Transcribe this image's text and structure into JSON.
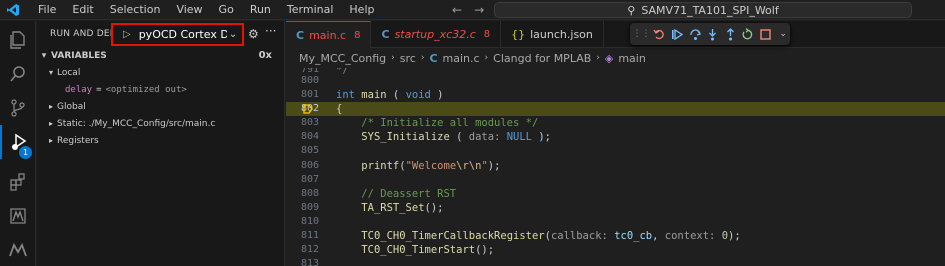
{
  "titlebar": {
    "menu": [
      "File",
      "Edit",
      "Selection",
      "View",
      "Go",
      "Run",
      "Terminal",
      "Help"
    ],
    "search_text": "SAMV71_TA101_SPI_Wolf"
  },
  "activitybar": {
    "items": [
      "explorer-icon",
      "search-icon",
      "source-control-icon",
      "run-debug-icon",
      "extensions-icon",
      "mplab-icon",
      "microchip-icon",
      "microchip-logo-icon"
    ],
    "badge": "1"
  },
  "sidebar": {
    "title": "RUN AND DEBUG",
    "config": "pyOCD Cortex Debug",
    "variables_header": "VARIABLES",
    "hex_toggle": "0x",
    "local_label": "Local",
    "local_var": {
      "name": "delay",
      "eq": "=",
      "value": "<optimized out>"
    },
    "global_label": "Global",
    "static_label": "Static: ./My_MCC_Config/src/main.c",
    "registers_label": "Registers"
  },
  "tabs": [
    {
      "icon": "C",
      "name": "main.c",
      "count": "8",
      "active": true
    },
    {
      "icon": "C",
      "name": "startup_xc32.c",
      "count": "8",
      "active": false
    },
    {
      "icon": "{}",
      "name": "launch.json",
      "count": "",
      "active": false
    }
  ],
  "breadcrumb": {
    "parts": [
      "My_MCC_Config",
      "src",
      "main.c",
      "Clangd for MPLAB",
      "main"
    ]
  },
  "debug_toolbar": [
    "grip-icon",
    "restart-frame-icon",
    "continue-icon",
    "step-over-icon",
    "step-into-icon",
    "step-out-icon",
    "restart-icon",
    "stop-icon"
  ],
  "code": {
    "current_line": "802",
    "lines": [
      {
        "n": "791",
        "t": "*/"
      },
      {
        "n": "800",
        "t": ""
      },
      {
        "n": "801",
        "t": "int main ( void )"
      },
      {
        "n": "802",
        "t": "{"
      },
      {
        "n": "803",
        "t": "    /* Initialize all modules */"
      },
      {
        "n": "804",
        "t": "    SYS_Initialize ( data: NULL );"
      },
      {
        "n": "805",
        "t": ""
      },
      {
        "n": "806",
        "t": "    printf(\"Welcome\\r\\n\");"
      },
      {
        "n": "807",
        "t": ""
      },
      {
        "n": "808",
        "t": "    // Deassert RST"
      },
      {
        "n": "809",
        "t": "    TA_RST_Set();"
      },
      {
        "n": "810",
        "t": ""
      },
      {
        "n": "811",
        "t": "    TC0_CH0_TimerCallbackRegister(callback: tc0_cb, context: 0);"
      },
      {
        "n": "812",
        "t": "    TC0_CH0_TimerStart();"
      },
      {
        "n": "813",
        "t": ""
      }
    ]
  },
  "colors": {
    "accent": "#0078d4",
    "highlight_box": "#e51400",
    "current_line_bg": "#4b4b18",
    "breakpoint": "#ffcc00"
  }
}
